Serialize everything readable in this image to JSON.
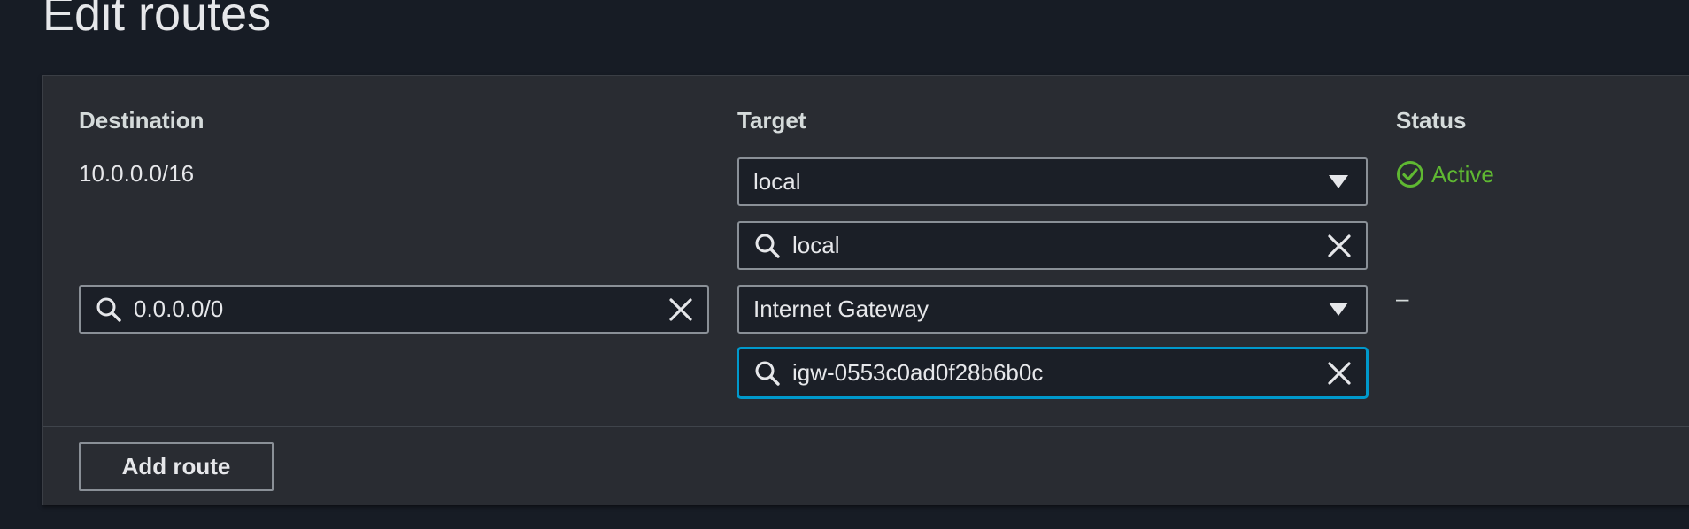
{
  "page": {
    "title": "Edit routes"
  },
  "columns": {
    "destination": "Destination",
    "target": "Target",
    "status": "Status"
  },
  "routes": [
    {
      "destination": "10.0.0.0/16",
      "target_type": "local",
      "target_search_value": "local",
      "status": "Active",
      "status_icon": "check-circle-icon",
      "status_color": "#5fb832"
    },
    {
      "destination_search_value": "0.0.0.0/0",
      "target_type": "Internet Gateway",
      "target_search_value": "igw-0553c0ad0f28b6b0c",
      "status": "–"
    }
  ],
  "actions": {
    "add_route_label": "Add route"
  },
  "icons": {
    "search": "search-icon",
    "clear": "clear-icon",
    "dropdown": "caret-down-icon"
  },
  "colors": {
    "background": "#171c25",
    "panel": "#292c32",
    "focus_ring": "#0099cc",
    "status_active": "#5fb832"
  }
}
